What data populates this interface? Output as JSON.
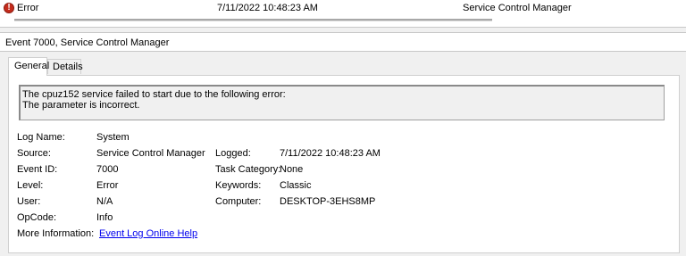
{
  "event_list": {
    "row": {
      "level": "Error",
      "date_time": "7/11/2022 10:48:23 AM",
      "source": "Service Control Manager"
    }
  },
  "details": {
    "title": "Event 7000, Service Control Manager",
    "tabs": [
      {
        "label": "General"
      },
      {
        "label": "Details"
      }
    ],
    "description": [
      "The cpuz152 service failed to start due to the following error:",
      "The parameter is incorrect."
    ],
    "properties": {
      "log_name": {
        "label": "Log Name:",
        "value": "System"
      },
      "source": {
        "label": "Source:",
        "value": "Service Control Manager"
      },
      "logged": {
        "label": "Logged:",
        "value": "7/11/2022 10:48:23 AM"
      },
      "event_id": {
        "label": "Event ID:",
        "value": "7000"
      },
      "task_category": {
        "label": "Task Category:",
        "value": "None"
      },
      "level": {
        "label": "Level:",
        "value": "Error"
      },
      "keywords": {
        "label": "Keywords:",
        "value": "Classic"
      },
      "user": {
        "label": "User:",
        "value": "N/A"
      },
      "computer": {
        "label": "Computer:",
        "value": "DESKTOP-3EHS8MP"
      },
      "opcode": {
        "label": "OpCode:",
        "value": "Info"
      },
      "more_info": {
        "label": "More Information:",
        "link": "Event Log Online Help"
      }
    }
  },
  "colors": {
    "error_icon": "#c42b1c",
    "link": "#0000ee"
  },
  "icons": {
    "level": "error-icon"
  }
}
